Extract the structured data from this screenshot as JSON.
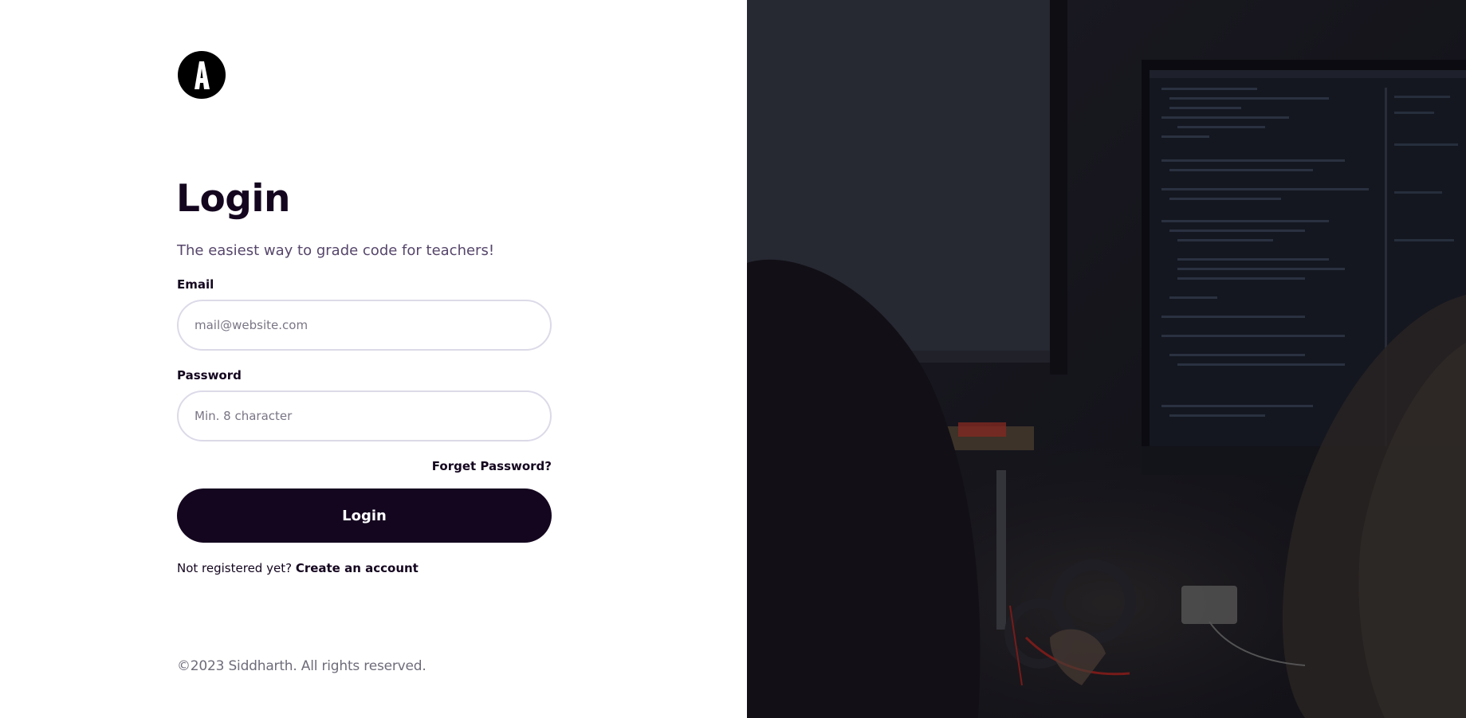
{
  "login": {
    "title": "Login",
    "subtitle": "The easiest way to grade code for teachers!",
    "email_label": "Email",
    "email_placeholder": "mail@website.com",
    "email_value": "",
    "password_label": "Password",
    "password_placeholder": "Min. 8 character",
    "password_value": "",
    "forget_password": "Forget Password?",
    "submit_label": "Login",
    "register_prompt": "Not registered yet?",
    "register_link": "Create an account"
  },
  "footer": {
    "copyright": "©2023 Siddharth. All rights reserved."
  },
  "icons": {
    "logo": "logo-a-icon"
  },
  "colors": {
    "primary": "#14061f",
    "subtitle": "#56466b",
    "input_border": "#dcdae8",
    "footer_text": "#6f6c7a"
  }
}
